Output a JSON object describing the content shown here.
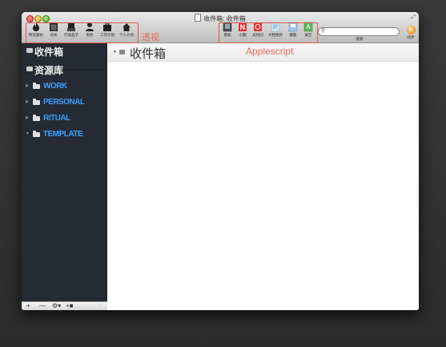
{
  "window": {
    "title": "收件箱: 收件箱"
  },
  "toolbar": {
    "perspectives": [
      {
        "label": "所有旗标",
        "icon": "flame-icon"
      },
      {
        "label": "日式",
        "icon": "calendar-icon"
      },
      {
        "label": "行动盒子",
        "icon": "inbox-tray-icon"
      },
      {
        "label": "角色",
        "icon": "person-icon"
      },
      {
        "label": "工作计划",
        "icon": "briefcase-icon"
      },
      {
        "label": "个人计划",
        "icon": "home-icon"
      }
    ],
    "scripts": [
      {
        "label": "看板",
        "icon": "kanban-icon"
      },
      {
        "label": "小翻",
        "icon": "n-icon"
      },
      {
        "label": "高时间",
        "icon": "clock-icon"
      },
      {
        "label": "文档更新",
        "icon": "doc-update-icon"
      },
      {
        "label": "模板",
        "icon": "template-icon"
      },
      {
        "label": "报告",
        "icon": "report-icon"
      }
    ],
    "search": {
      "label": "搜索",
      "value": ""
    },
    "sync_label": "同步"
  },
  "annotations": {
    "perspectives_label": "透视",
    "scripts_label": "Applescript",
    "color": "#e0584a"
  },
  "sidebar": {
    "inbox_label": "收件箱",
    "library_label": "资源库",
    "folders": [
      {
        "label": "WORK"
      },
      {
        "label": "PERSONAL"
      },
      {
        "label": "RITUAL"
      },
      {
        "label": "TEMPLATE"
      }
    ],
    "bottom_buttons": [
      "+",
      "—",
      "⚙▾",
      "+■"
    ]
  },
  "main": {
    "header_title": "收件箱"
  },
  "colors": {
    "sidebar_bg": "#252a34",
    "folder_text": "#3aa0ff",
    "annotation": "#e0584a"
  }
}
